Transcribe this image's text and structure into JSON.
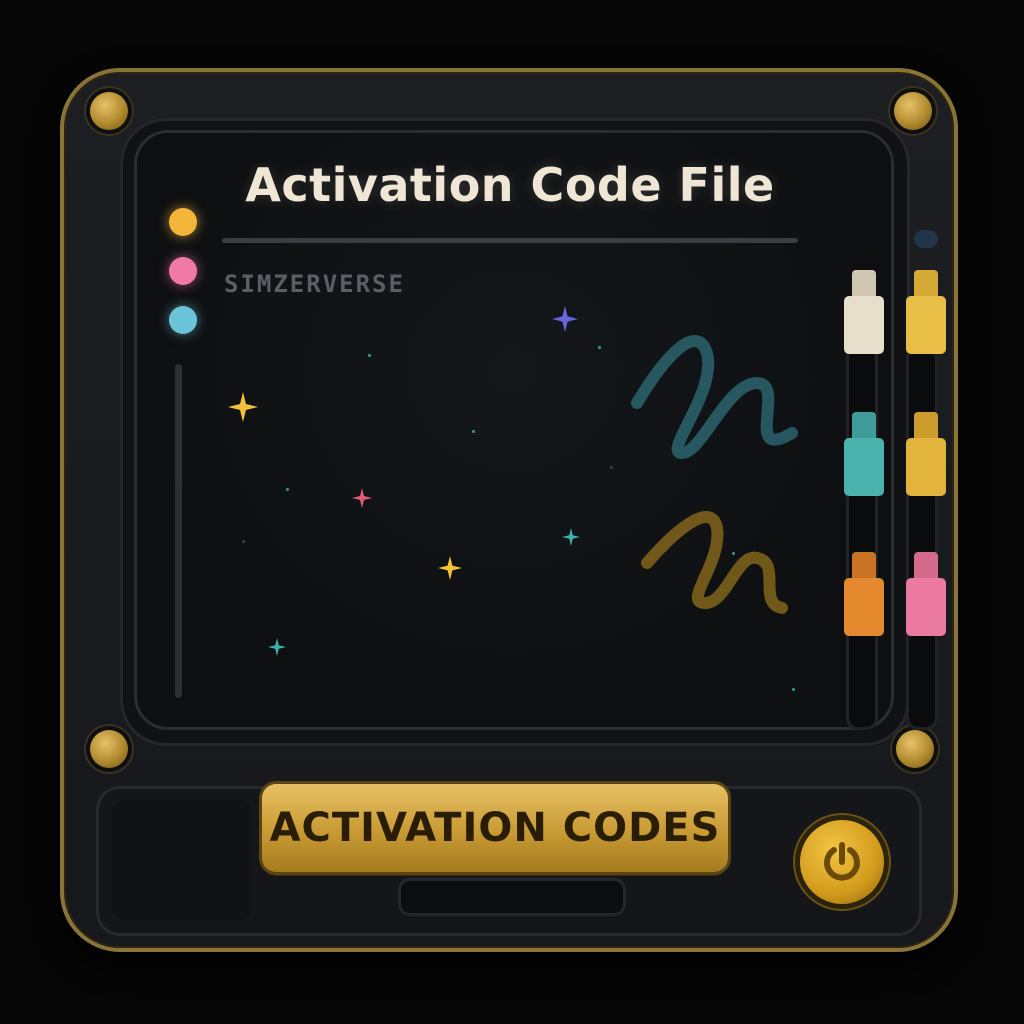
{
  "screen": {
    "title": "Activation Code File",
    "brand": "SIMZERVERSE"
  },
  "controls": {
    "action_label": "ACTIVATION CODES",
    "power_icon": "power-icon"
  },
  "leds": [
    {
      "name": "led-yellow",
      "color": "#f3b63a"
    },
    {
      "name": "led-pink",
      "color": "#ef7aa6"
    },
    {
      "name": "led-cyan",
      "color": "#6bc4d8"
    }
  ],
  "sliders": [
    {
      "name": "slider-cream",
      "color": "#e6dfcc",
      "cap": "#cfc7b2"
    },
    {
      "name": "slider-gold-top",
      "color": "#e8be46",
      "cap": "#d4a934"
    },
    {
      "name": "slider-teal",
      "color": "#4ab3ae",
      "cap": "#3f9c98"
    },
    {
      "name": "slider-gold-mid",
      "color": "#e3b43c",
      "cap": "#cc9d2c"
    },
    {
      "name": "slider-orange",
      "color": "#e5892e",
      "cap": "#c97424"
    },
    {
      "name": "slider-pink",
      "color": "#eb7aa0",
      "cap": "#d46a8c"
    }
  ],
  "colors": {
    "accent_gold": "#c89a34",
    "screen_bg": "#0d0f11",
    "scribble_teal": "#2f6f7a",
    "scribble_gold": "#8a6a1c"
  }
}
